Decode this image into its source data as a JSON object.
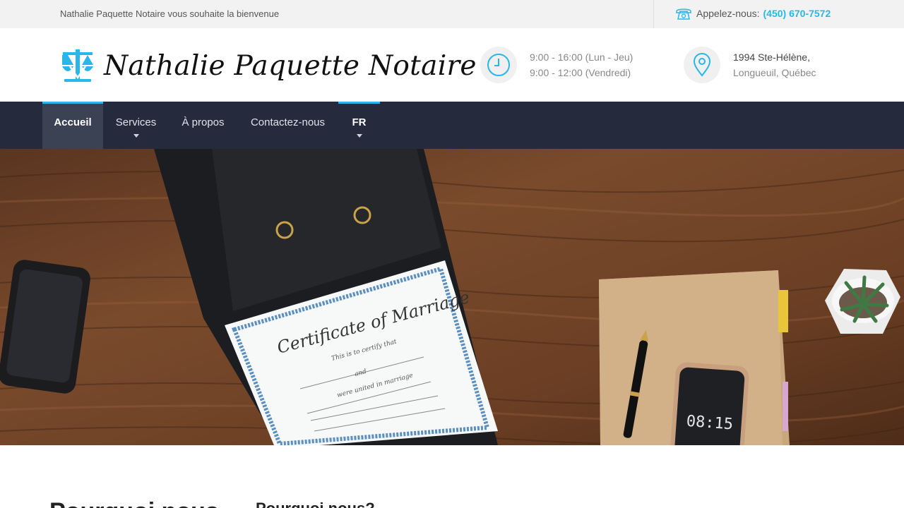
{
  "topbar": {
    "welcome": "Nathalie Paquette Notaire vous souhaite la bienvenue",
    "call_label": "Appelez-nous:",
    "phone": "(450) 670-7572"
  },
  "header": {
    "logo_text": "Nathalie Paquette Notaire",
    "hours_line1": "9:00 - 16:00 (Lun - Jeu)",
    "hours_line2": "9:00 - 12:00 (Vendredi)",
    "address_line1": "1994 Ste-Hélène,",
    "address_line2": "Longueuil, Québec"
  },
  "nav": {
    "items": [
      {
        "label": "Accueil"
      },
      {
        "label": "Services"
      },
      {
        "label": "À propos"
      },
      {
        "label": "Contactez-nous"
      },
      {
        "label": "FR"
      }
    ]
  },
  "hero": {
    "certificate_title": "Certificate of Marriage",
    "certificate_sub1": "This is to certify that",
    "certificate_and": "and",
    "certificate_sub2": "were united in marriage",
    "phone_time": "08:15"
  },
  "below": {
    "left_heading": "Pourquoi nous",
    "right_heading": "Pourquoi nous?"
  },
  "colors": {
    "accent": "#29b6e8",
    "nav_bg": "#252b3d",
    "topbar_bg": "#f2f2f2"
  }
}
